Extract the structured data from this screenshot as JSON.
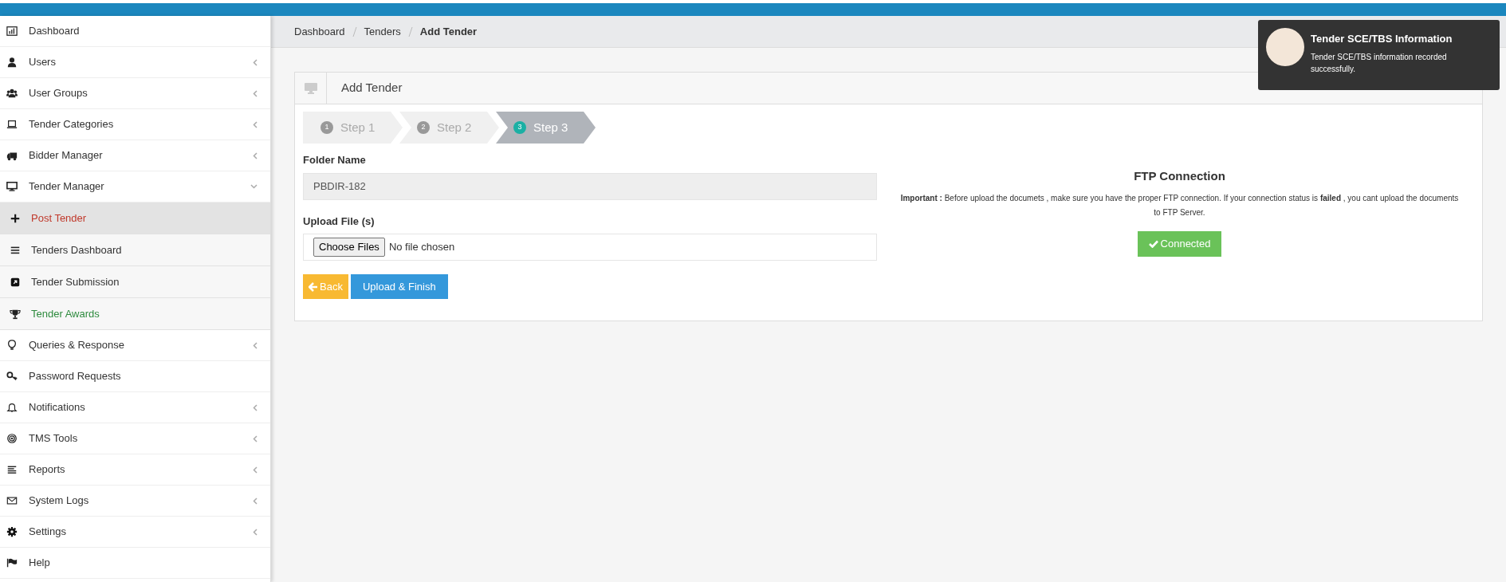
{
  "sidebar": {
    "items": [
      {
        "label": "Dashboard",
        "has_arrow": false
      },
      {
        "label": "Users",
        "has_arrow": true
      },
      {
        "label": "User Groups",
        "has_arrow": true
      },
      {
        "label": "Tender Categories",
        "has_arrow": true
      },
      {
        "label": "Bidder Manager",
        "has_arrow": true
      },
      {
        "label": "Tender Manager",
        "has_arrow": true,
        "expanded": true,
        "children": [
          {
            "label": "Post Tender",
            "selected": true,
            "color": "#c0392b"
          },
          {
            "label": "Tenders Dashboard",
            "selected": false,
            "color": "#333333"
          },
          {
            "label": "Tender Submission",
            "selected": false,
            "color": "#333333"
          },
          {
            "label": "Tender Awards",
            "selected": false,
            "color": "#2e8b3e"
          }
        ]
      },
      {
        "label": "Queries & Response",
        "has_arrow": true
      },
      {
        "label": "Password Requests",
        "has_arrow": false
      },
      {
        "label": "Notifications",
        "has_arrow": true
      },
      {
        "label": "TMS Tools",
        "has_arrow": true
      },
      {
        "label": "Reports",
        "has_arrow": true
      },
      {
        "label": "System Logs",
        "has_arrow": true
      },
      {
        "label": "Settings",
        "has_arrow": true
      },
      {
        "label": "Help",
        "has_arrow": false
      }
    ]
  },
  "breadcrumb": [
    "Dashboard",
    "Tenders",
    "Add Tender"
  ],
  "panel": {
    "title": "Add Tender",
    "steps": [
      {
        "number": "1",
        "label": "Step 1",
        "selected": false
      },
      {
        "number": "2",
        "label": "Step 2",
        "selected": false
      },
      {
        "number": "3",
        "label": "Step 3",
        "selected": true
      }
    ],
    "folder_label": "Folder Name",
    "folder_value": "PBDIR-182",
    "upload_label": "Upload File (s)",
    "choose_button": "Choose Files",
    "file_status": "No file chosen",
    "back_button": "Back",
    "finish_button": "Upload & Finish",
    "ftp": {
      "title": "FTP Connection",
      "note": "**Important :** Before upload the documets , make sure you have the proper FTP connection. If your connection status is **failed** , you cant upload the documents to FTP Server.",
      "status": "Connected"
    }
  },
  "toast": {
    "title": "Tender SCE/TBS Information",
    "message": "Tender SCE/TBS information recorded successfully."
  }
}
